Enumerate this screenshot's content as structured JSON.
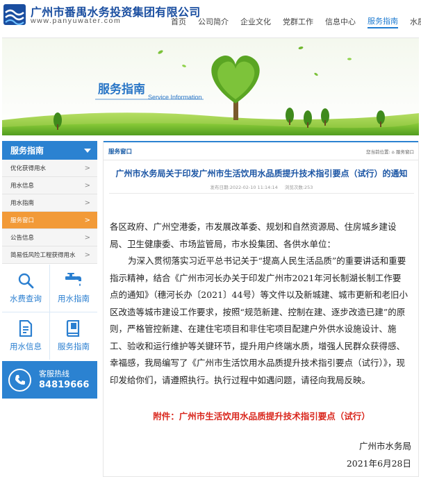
{
  "header": {
    "logo_cn": "广州市番禺水务投资集团有限公司",
    "logo_en": "www.panyuwater.com",
    "nav": [
      "首页",
      "公司简介",
      "企业文化",
      "党群工作",
      "信息中心",
      "服务指南",
      "水质监测"
    ],
    "active_nav": "服务指南"
  },
  "banner": {
    "title": "服务指南",
    "subtitle": "Service Information"
  },
  "sidebar": {
    "heading": "服务指南",
    "items": [
      {
        "label": "优化获得用水"
      },
      {
        "label": "用水信息"
      },
      {
        "label": "用水指南"
      },
      {
        "label": "服务窗口"
      },
      {
        "label": "公告信息"
      },
      {
        "label": "简易低风险工程获得用水"
      }
    ],
    "active_item": "服务窗口",
    "quick_links": [
      {
        "label": "水费查询",
        "icon": "search-icon"
      },
      {
        "label": "用水指南",
        "icon": "faucet-icon"
      },
      {
        "label": "用水信息",
        "icon": "document-icon"
      },
      {
        "label": "服务指南",
        "icon": "book-icon"
      }
    ],
    "hotline": {
      "label": "客服热线",
      "number": "84819666",
      "icon": "phone-icon"
    }
  },
  "main": {
    "section": "服务窗口",
    "location": "您当前位置: ⌂ 服务窗口",
    "article": {
      "title": "广州市水务局关于印发广州市生活饮用水品质提升技术指引要点（试行）的通知",
      "publish_time": "发布日期:2022-02-10 11:14:14",
      "views": "浏览次数:253",
      "paragraphs": [
        "各区政府、广州空港委，市发展改革委、规划和自然资源局、住房城乡建设局、卫生健康委、市场监管局，市水投集团、各供水单位：",
        "为深入贯彻落实习近平总书记关于“提高人民生活品质”的重要讲话和重要指示精神，结合《广州市河长办关于印发广州市2021年河长制湖长制工作要点的通知》（穗河长办〔2021〕44号）等文件以及新城建、城市更新和老旧小区改造等城市建设工作要求，按照“规范新建、控制在建、逐步改造已建”的原则，严格管控新建、在建住宅项目和非住宅项目配建户外供水设施设计、施工、验收和运行维护等关键环节，提升用户终端水质，增强人民群众获得感、幸福感，我局编写了《广州市生活饮用水品质提升技术指引要点（试行）》，现印发给你们，请遵照执行。执行过程中如遇问题，请径向我局反映。"
      ],
      "attachment": "附件：广州市生活饮用水品质提升技术指引要点（试行）",
      "signature": "广州市水务局",
      "date": "2021年6月28日"
    }
  }
}
